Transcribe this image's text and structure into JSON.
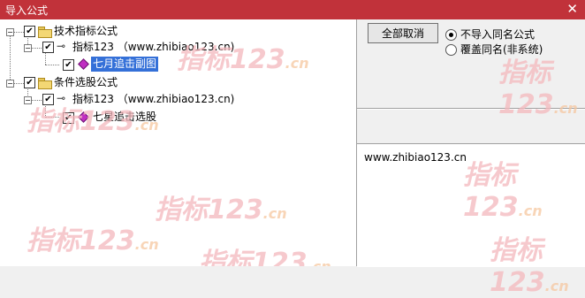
{
  "window": {
    "title": "导入公式",
    "close_glyph": "✕"
  },
  "tree": {
    "categories": [
      {
        "label": "技术指标公式",
        "checked": true,
        "expander": "−",
        "formula": {
          "label": "指标123 （www.zhibiao123.cn)",
          "checked": true,
          "expander": "−",
          "item": {
            "label": "七月追击副图",
            "checked": true,
            "selected": true
          }
        }
      },
      {
        "label": "条件选股公式",
        "checked": true,
        "expander": "−",
        "formula": {
          "label": "指标123 （www.zhibiao123.cn)",
          "checked": true,
          "expander": "−",
          "item": {
            "label": "七星追击选股",
            "checked": true,
            "selected": false
          }
        }
      }
    ]
  },
  "actions": {
    "cancel_all_label": "全部取消"
  },
  "import_options": [
    {
      "label": "不导入同名公式",
      "checked": true
    },
    {
      "label": "覆盖同名(非系统)",
      "checked": false
    }
  ],
  "info": {
    "text": "www.zhibiao123.cn"
  },
  "watermark": {
    "text": "指标123",
    "suffix": ".cn"
  },
  "colors": {
    "title_bar": "#c1323a",
    "selection": "#3470d8",
    "watermark": "#f4b8bd"
  }
}
